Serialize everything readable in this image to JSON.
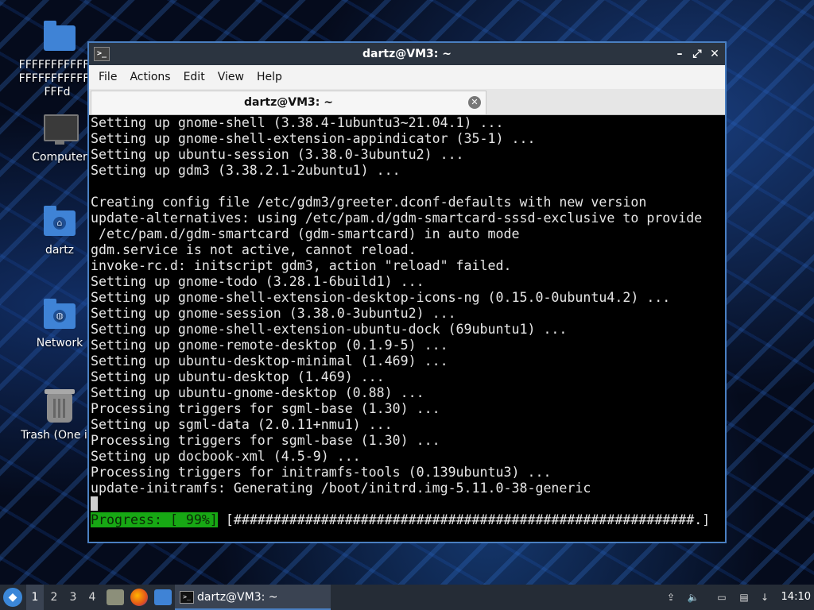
{
  "desktop": {
    "icons": [
      {
        "label": "FFFFFFFFFFFFFFFFFFFFFFFFFFFd",
        "icon": "folder-icon"
      },
      {
        "label": "Computer",
        "icon": "computer-icon"
      },
      {
        "label": "dartz",
        "icon": "home-folder-icon"
      },
      {
        "label": "Network",
        "icon": "network-folder-icon"
      },
      {
        "label": "Trash (One ite",
        "icon": "trash-icon"
      }
    ]
  },
  "window": {
    "title": "dartz@VM3: ~",
    "controls": {
      "minimize": "–",
      "maximize": "⤢",
      "close": "✕"
    },
    "menu": {
      "file": "File",
      "actions": "Actions",
      "edit": "Edit",
      "view": "View",
      "help": "Help"
    },
    "tab": {
      "label": "dartz@VM3: ~",
      "close": "✕"
    }
  },
  "terminal": {
    "lines": [
      "Setting up gnome-shell (3.38.4-1ubuntu3~21.04.1) ...",
      "Setting up gnome-shell-extension-appindicator (35-1) ...",
      "Setting up ubuntu-session (3.38.0-3ubuntu2) ...",
      "Setting up gdm3 (3.38.2.1-2ubuntu1) ...",
      "",
      "Creating config file /etc/gdm3/greeter.dconf-defaults with new version",
      "update-alternatives: using /etc/pam.d/gdm-smartcard-sssd-exclusive to provide",
      " /etc/pam.d/gdm-smartcard (gdm-smartcard) in auto mode",
      "gdm.service is not active, cannot reload.",
      "invoke-rc.d: initscript gdm3, action \"reload\" failed.",
      "Setting up gnome-todo (3.28.1-6build1) ...",
      "Setting up gnome-shell-extension-desktop-icons-ng (0.15.0-0ubuntu4.2) ...",
      "Setting up gnome-session (3.38.0-3ubuntu2) ...",
      "Setting up gnome-shell-extension-ubuntu-dock (69ubuntu1) ...",
      "Setting up gnome-remote-desktop (0.1.9-5) ...",
      "Setting up ubuntu-desktop-minimal (1.469) ...",
      "Setting up ubuntu-desktop (1.469) ...",
      "Setting up ubuntu-gnome-desktop (0.88) ...",
      "Processing triggers for sgml-base (1.30) ...",
      "Setting up sgml-data (2.0.11+nmu1) ...",
      "Processing triggers for sgml-base (1.30) ...",
      "Setting up docbook-xml (4.5-9) ...",
      "Processing triggers for initramfs-tools (0.139ubuntu3) ...",
      "update-initramfs: Generating /boot/initrd.img-5.11.0-38-generic"
    ],
    "progress_label": "Progress: [ 99%]",
    "progress_bar": " [##########################################################.]",
    "progress_value": 0.99
  },
  "taskbar": {
    "workspaces": [
      "1",
      "2",
      "3",
      "4"
    ],
    "active_workspace": "1",
    "task_label": "dartz@VM3: ~",
    "clock": "14:10"
  },
  "colors": {
    "window_border": "#4a7fc1",
    "progress_green": "#17a814",
    "taskbar": "#252c36"
  }
}
